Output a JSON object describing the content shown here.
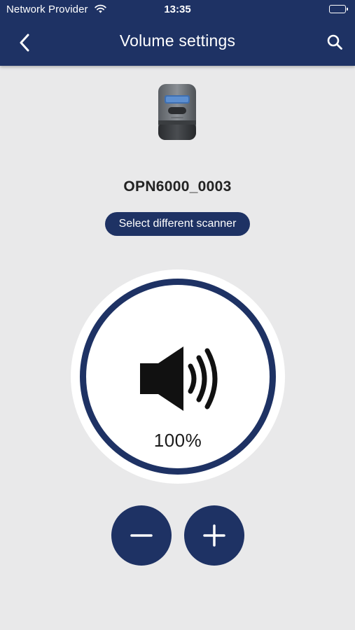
{
  "status_bar": {
    "carrier": "Network Provider",
    "time": "13:35",
    "wifi_icon": "wifi-icon",
    "battery_icon": "battery-icon"
  },
  "nav": {
    "title": "Volume settings",
    "back_icon": "chevron-left-icon",
    "search_icon": "search-icon"
  },
  "scanner": {
    "image_icon": "scanner-device-image",
    "name": "OPN6000_0003",
    "select_label": "Select different scanner"
  },
  "volume": {
    "icon": "speaker-icon",
    "level_text": "100%",
    "level_fraction": 1.0,
    "decrease_icon": "minus-icon",
    "increase_icon": "plus-icon"
  },
  "colors": {
    "header_bg": "#1e3264",
    "page_bg": "#e9e9ea",
    "accent": "#1e3264",
    "dial_bg": "#ffffff",
    "text_dark": "#222222"
  }
}
